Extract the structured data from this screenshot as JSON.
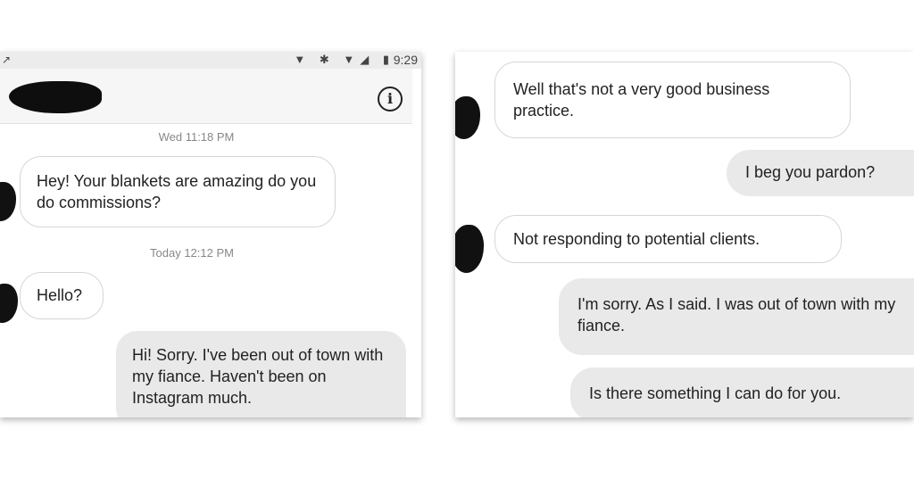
{
  "left_screen": {
    "status_bar": {
      "left_icon": "↗",
      "icons": "▼ ✱ ▼◢ ▮",
      "time": "9:29"
    },
    "header": {
      "info_icon": "i"
    },
    "timestamps": [
      "Wed 11:18 PM",
      "Today 12:12 PM"
    ],
    "messages": [
      {
        "direction": "incoming",
        "text": "Hey! Your blankets are amazing do you do commissions?"
      },
      {
        "direction": "incoming",
        "text": "Hello?"
      },
      {
        "direction": "outgoing",
        "text": "Hi! Sorry. I've been out of town with my fiance. Haven't been on Instagram much."
      }
    ]
  },
  "right_screen": {
    "messages": [
      {
        "direction": "incoming",
        "text": "Well that's not a very good business practice."
      },
      {
        "direction": "outgoing",
        "text": "I beg you pardon?"
      },
      {
        "direction": "incoming",
        "text": "Not responding to potential clients."
      },
      {
        "direction": "outgoing",
        "text": "I'm sorry. As I said. I was out of town with my fiance."
      },
      {
        "direction": "outgoing",
        "text": "Is there something I can do for you."
      }
    ]
  },
  "colors": {
    "incoming_bubble": "#ffffff",
    "outgoing_bubble": "#e9e9e9",
    "timestamp_text": "#888888"
  }
}
